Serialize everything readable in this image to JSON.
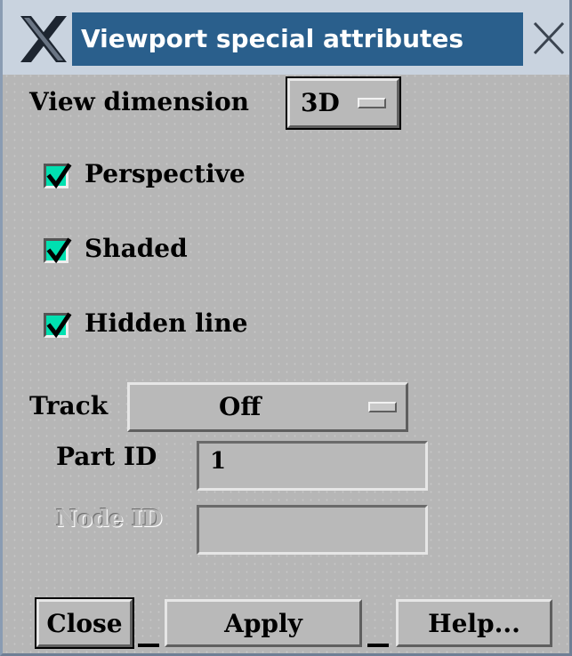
{
  "window": {
    "title": "Viewport special attributes"
  },
  "icons": {
    "window_menu": "x-window-icon",
    "close": "close-icon",
    "checkmark": "checkmark-icon",
    "dropdown_indicator": "option-menu-indicator-icon"
  },
  "colors": {
    "title_bar": "#2a5f8c",
    "title_text": "#ffffff",
    "checkbox_on": "#00e0b0",
    "panel": "#b6b6b6"
  },
  "view_dimension": {
    "label": "View dimension",
    "value": "3D"
  },
  "options": {
    "perspective": {
      "label": "Perspective",
      "checked": true
    },
    "shaded": {
      "label": "Shaded",
      "checked": true
    },
    "hidden_line": {
      "label": "Hidden line",
      "checked": true
    }
  },
  "track": {
    "label": "Track",
    "value": "Off"
  },
  "part_id": {
    "label": "Part ID",
    "value": "1"
  },
  "node_id": {
    "label": "Node ID",
    "value": "",
    "enabled": false
  },
  "buttons": {
    "close": "Close",
    "apply": "Apply",
    "help": "Help..."
  }
}
